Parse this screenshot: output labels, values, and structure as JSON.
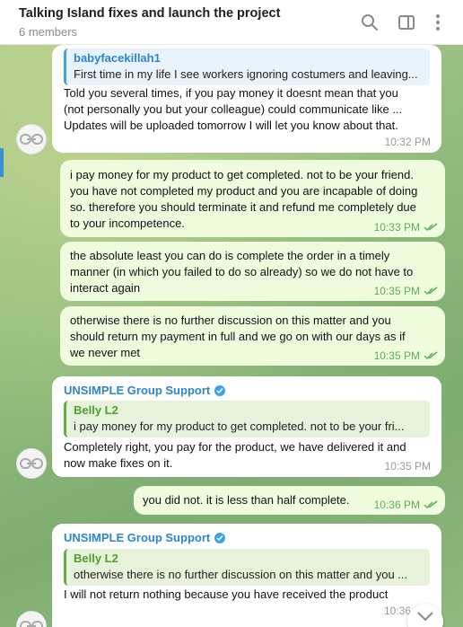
{
  "header": {
    "title": "Talking Island fixes and launch the project",
    "subtitle": "6 members"
  },
  "messages": [
    {
      "reply_name": "babyfacekillah1",
      "reply_text": "First time in my life I see workers ignoring costumers and leaving...",
      "lines": [
        "Told you several times, if you pay money it doesnt mean that you",
        "(not personally you but your colleague) could communicate like ...",
        "Updates will be uploaded tomorrow I will let you know about that."
      ],
      "time": "10:32 PM"
    },
    {
      "lines": [
        "i pay money for my product to get completed. not to be your friend.",
        "you have not completed my product and you are incapable of doing",
        "so. therefore you should terminate it and refund me completely due",
        "to your incompetence."
      ],
      "time": "10:33 PM"
    },
    {
      "lines": [
        "the absolute least you can do is complete the order in a timely",
        "manner (in which you failed to do so already) so we do not have to",
        "interact again"
      ],
      "time": "10:35 PM"
    },
    {
      "lines": [
        "otherwise there is no further discussion on this matter and you",
        "should return my payment in full and we go on with our days as if",
        "we never met"
      ],
      "time": "10:35 PM"
    },
    {
      "sender": "UNSIMPLE Group Support",
      "reply_name": "Belly L2",
      "reply_text": "i pay money for my product to get completed. not to be your fri...",
      "lines": [
        "Completely right, you pay for the product, we have delivered it and",
        "now make fixes on it."
      ],
      "time": "10:35 PM"
    },
    {
      "lines": [
        "you did not. it is less than half complete."
      ],
      "time": "10:36 PM"
    },
    {
      "sender": "UNSIMPLE Group Support",
      "reply_name": "Belly L2",
      "reply_text": "otherwise there is no further discussion on this matter and you ...",
      "lines": [
        "I will not return nothing because you have received the product"
      ],
      "time": "10:36"
    }
  ],
  "colors": {
    "accent": "#2e86c9",
    "outgoing": "#effdde",
    "incoming": "#ffffff",
    "check": "#5fae5a"
  }
}
